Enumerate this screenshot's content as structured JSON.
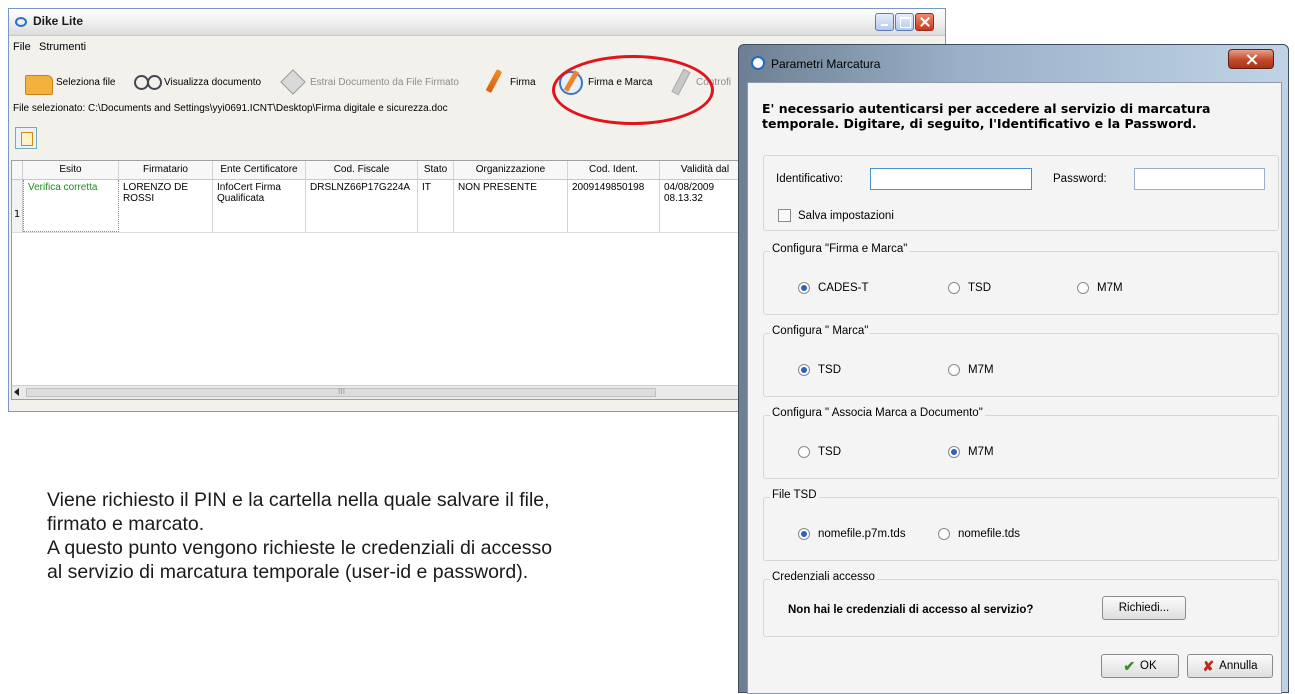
{
  "dike": {
    "title": "Dike Lite",
    "menu": [
      "File",
      "Strumenti"
    ],
    "toolbar": {
      "select_file": "Seleziona file",
      "view_document": "Visualizza documento",
      "extract_document": "Estrai Documento da File Firmato",
      "sign": "Firma",
      "sign_and_stamp": "Firma e Marca",
      "countersign": "Controfi"
    },
    "selected_file": "File selezionato: C:\\Documents and Settings\\yyi0691.ICNT\\Desktop\\Firma digitale e sicurezza.doc",
    "table": {
      "columns": [
        "Esito",
        "Firmatario",
        "Ente Certificatore",
        "Cod. Fiscale",
        "Stato",
        "Organizzazione",
        "Cod. Ident.",
        "Validità dal"
      ],
      "rows": [
        {
          "index": "1",
          "esito": "Verifica corretta",
          "firmatario": "LORENZO DE ROSSI",
          "ente": "InfoCert Firma Qualificata",
          "cod_fiscale": "DRSLNZ66P17G224A",
          "stato": "IT",
          "organizzazione": "NON PRESENTE",
          "cod_ident": "2009149850198",
          "validita": "04/08/2009 08.13.32"
        }
      ]
    },
    "scroll_marker": "III"
  },
  "caption": {
    "line1": "Viene richiesto il PIN e la cartella nella quale salvare il file,",
    "line2": "firmato e marcato.",
    "line3": "A questo punto vengono richieste le credenziali di accesso",
    "line4": "al servizio di marcatura temporale (user-id e password)."
  },
  "dialog": {
    "title": "Parametri Marcatura",
    "intro": "E' necessario autenticarsi per accedere al servizio di marcatura temporale. Digitare, di seguito, l'Identificativo e la Password.",
    "id_label": "Identificativo:",
    "id_value": "",
    "password_label": "Password:",
    "password_value": "",
    "save_settings": "Salva impostazioni",
    "group_firma_marca": {
      "title": "Configura \"Firma e Marca\"",
      "options": [
        "CADES-T",
        "TSD",
        "M7M"
      ],
      "selected": "CADES-T"
    },
    "group_marca": {
      "title": "Configura \" Marca\"",
      "options": [
        "TSD",
        "M7M"
      ],
      "selected": "TSD"
    },
    "group_associa": {
      "title": "Configura \" Associa Marca a Documento\"",
      "options": [
        "TSD",
        "M7M"
      ],
      "selected": "M7M"
    },
    "group_file_tsd": {
      "title": "File TSD",
      "options": [
        "nomefile.p7m.tds",
        "nomefile.tds"
      ],
      "selected": "nomefile.p7m.tds"
    },
    "group_credenziali": {
      "title": "Credenziali accesso",
      "question": "Non hai le credenziali di accesso al servizio?",
      "request_button": "Richiedi..."
    },
    "ok_button": "OK",
    "cancel_button": "Annulla"
  }
}
